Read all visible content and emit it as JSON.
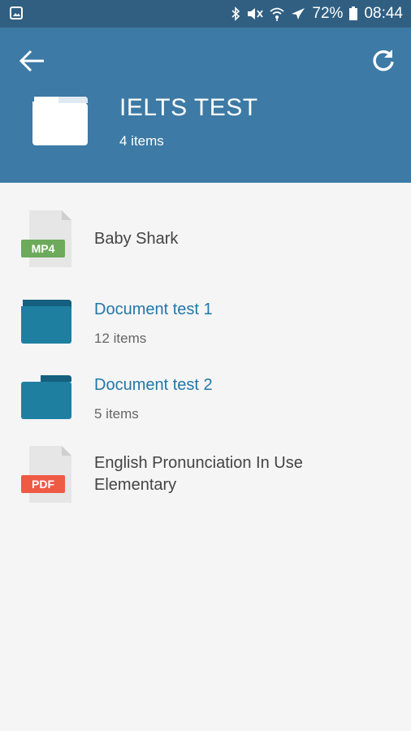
{
  "status_bar": {
    "left_icon": "image-notification-icon",
    "battery_percent": "72%",
    "time": "08:44",
    "icons": [
      "bluetooth-icon",
      "mute-icon",
      "wifi-icon",
      "airplane-icon",
      "battery-icon"
    ]
  },
  "header": {
    "title": "IELTS TEST",
    "subtitle": "4 items",
    "back_icon": "back-arrow-icon",
    "refresh_icon": "refresh-icon"
  },
  "files": [
    {
      "name": "Baby Shark",
      "type": "MP4",
      "kind": "file",
      "badge_color": "#6daa5b"
    },
    {
      "name": "Document test 1",
      "subtitle": "12 items",
      "kind": "folder"
    },
    {
      "name": "Document test 2",
      "subtitle": "5 items",
      "kind": "folder"
    },
    {
      "name": "English Pronunciation In Use Elementary",
      "type": "PDF",
      "kind": "file",
      "badge_color": "#ef5a45"
    }
  ],
  "colors": {
    "status_bar": "#305f82",
    "header": "#3d7aa5",
    "folder": "#1e7fa1",
    "folder_tab": "#14607e",
    "folder_link_text": "#2277a7",
    "background": "#f5f5f5"
  }
}
